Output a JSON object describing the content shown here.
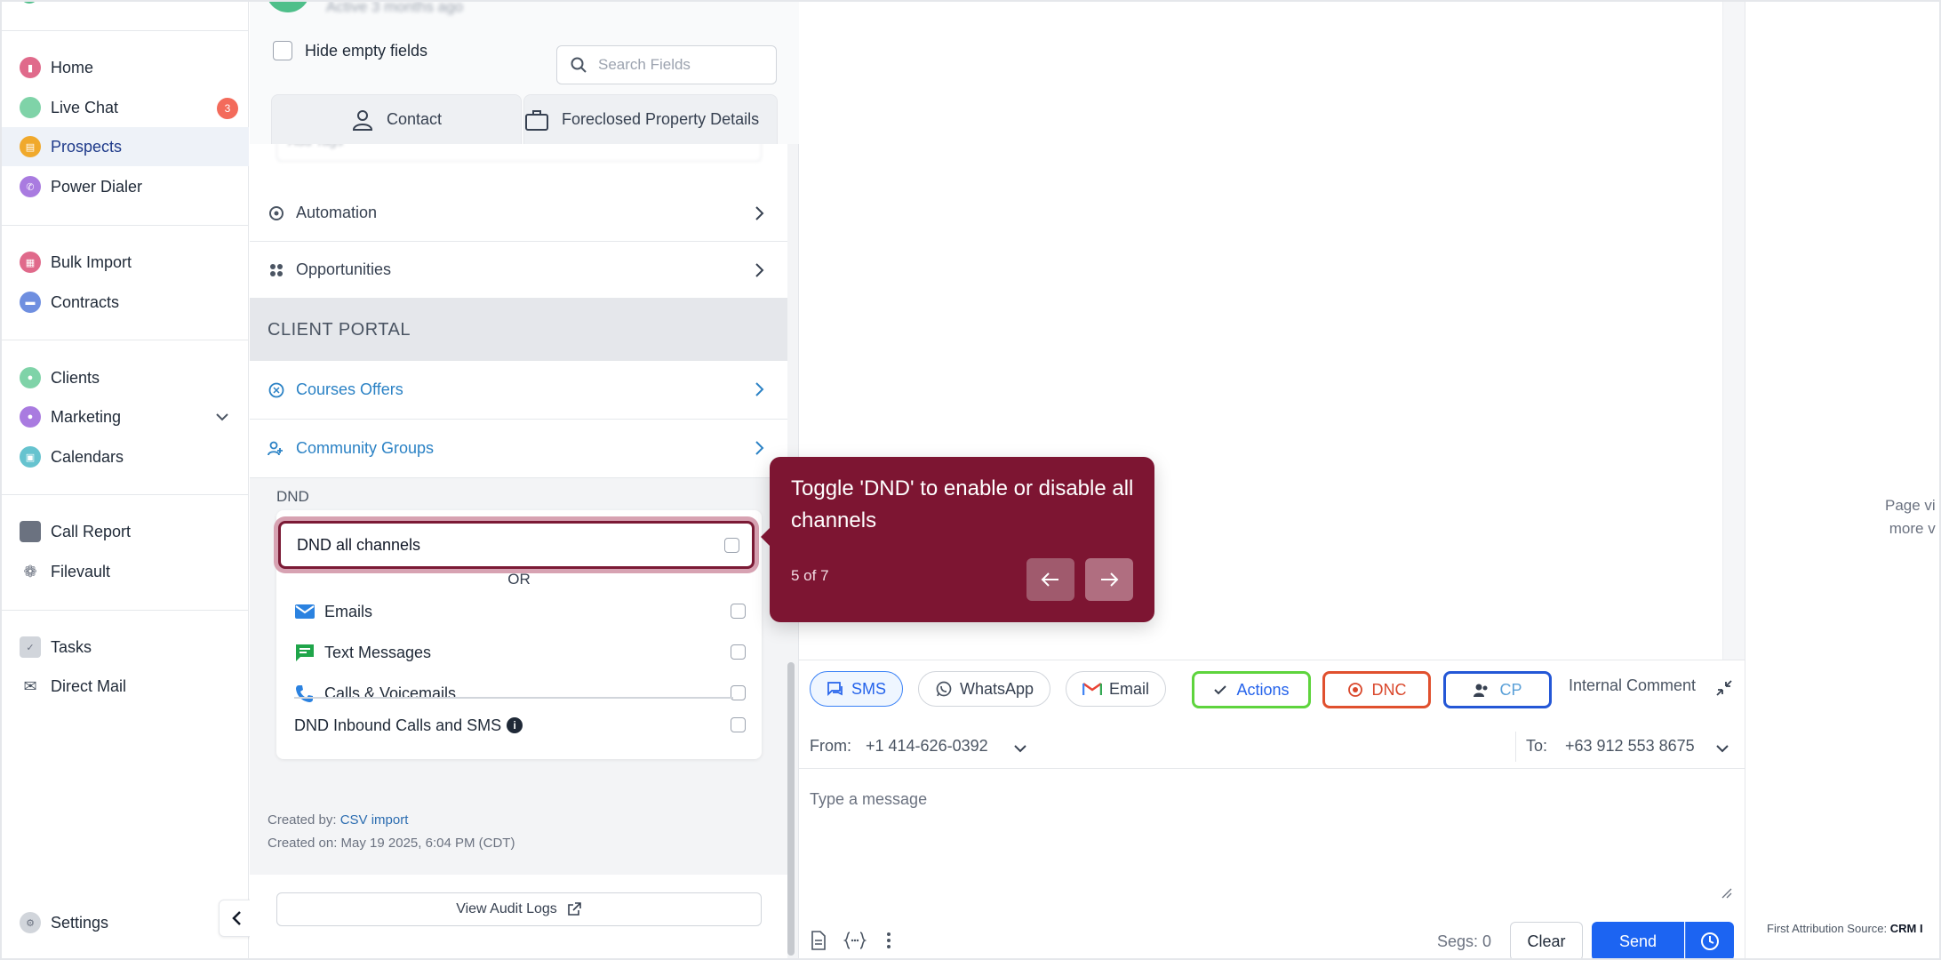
{
  "nav": {
    "items": [
      {
        "label": "Home",
        "color": "#e06a8b",
        "icon": "home-icon"
      },
      {
        "label": "Live Chat",
        "color": "#7fd3a8",
        "icon": "chat-icon",
        "badge": "3"
      },
      {
        "label": "Prospects",
        "color": "#f0a92c",
        "icon": "prospects-icon",
        "active": true
      },
      {
        "label": "Power Dialer",
        "color": "#a97be0",
        "icon": "phone-icon"
      },
      {
        "label": "Bulk Import",
        "color": "#e06a8b",
        "icon": "import-icon"
      },
      {
        "label": "Contracts",
        "color": "#6f8fe0",
        "icon": "contracts-icon"
      },
      {
        "label": "Clients",
        "color": "#7fd3a8",
        "icon": "clients-icon"
      },
      {
        "label": "Marketing",
        "color": "#a97be0",
        "icon": "marketing-icon"
      },
      {
        "label": "Calendars",
        "color": "#66c3cf",
        "icon": "calendar-icon"
      },
      {
        "label": "Call Report",
        "color": "#6b7280",
        "icon": "report-icon"
      },
      {
        "label": "Filevault",
        "color": "#6b7280",
        "icon": "paw-icon"
      },
      {
        "label": "Tasks",
        "color": "#c4c8ce",
        "icon": "tasks-icon"
      },
      {
        "label": "Direct Mail",
        "color": "#4b5563",
        "icon": "mail-icon"
      },
      {
        "label": "Settings",
        "color": "#c4c8ce",
        "icon": "settings-icon"
      }
    ]
  },
  "detail": {
    "blurred_status": "Active 3 months ago",
    "hide_empty_label": "Hide empty fields",
    "search_placeholder": "Search Fields",
    "tabs": [
      "Contact",
      "Foreclosed Property Details"
    ],
    "blurred_field": "Add Tags",
    "rows": {
      "automation": "Automation",
      "opportunities": "Opportunities",
      "client_portal": "CLIENT PORTAL",
      "courses_offers": "Courses Offers",
      "community_groups": "Community Groups"
    },
    "dnd": {
      "section_label": "DND",
      "all_channels": "DND all channels",
      "or": "OR",
      "emails": "Emails",
      "text_messages": "Text Messages",
      "calls": "Calls & Voicemails",
      "inbound": "DND Inbound Calls and SMS"
    },
    "created_by_label": "Created by:",
    "created_by_source": "CSV import",
    "created_on": "Created on: May 19 2025, 6:04 PM (CDT)",
    "audit_button": "View Audit Logs"
  },
  "composer": {
    "channels": [
      "SMS",
      "WhatsApp",
      "Email"
    ],
    "actions": "Actions",
    "dnc": "DNC",
    "cp": "CP",
    "internal_comment": "Internal Comment",
    "from_label": "From:",
    "from_number": "+1 414-626-0392",
    "to_label": "To:",
    "to_number": "+63 912 553 8675",
    "message_placeholder": "Type a message",
    "segs": "Segs: 0",
    "clear": "Clear",
    "send": "Send"
  },
  "right_panel": {
    "page_visit_line1": "Page vi",
    "page_visit_line2": "more v",
    "first_attribution_label": "First Attribution Source:",
    "first_attribution_value": "CRM I"
  },
  "tooltip": {
    "text": "Toggle 'DND' to enable or disable all channels",
    "step": "5 of 7"
  },
  "colors": {
    "tooltip_bg": "#7d1532",
    "highlight_ring": "#d7a2b2",
    "send_blue": "#1c64f2",
    "actions_green": "#5ed43d",
    "dnc_red": "#e0502e",
    "cp_blue": "#2457d6",
    "link_blue": "#2b82c5"
  }
}
